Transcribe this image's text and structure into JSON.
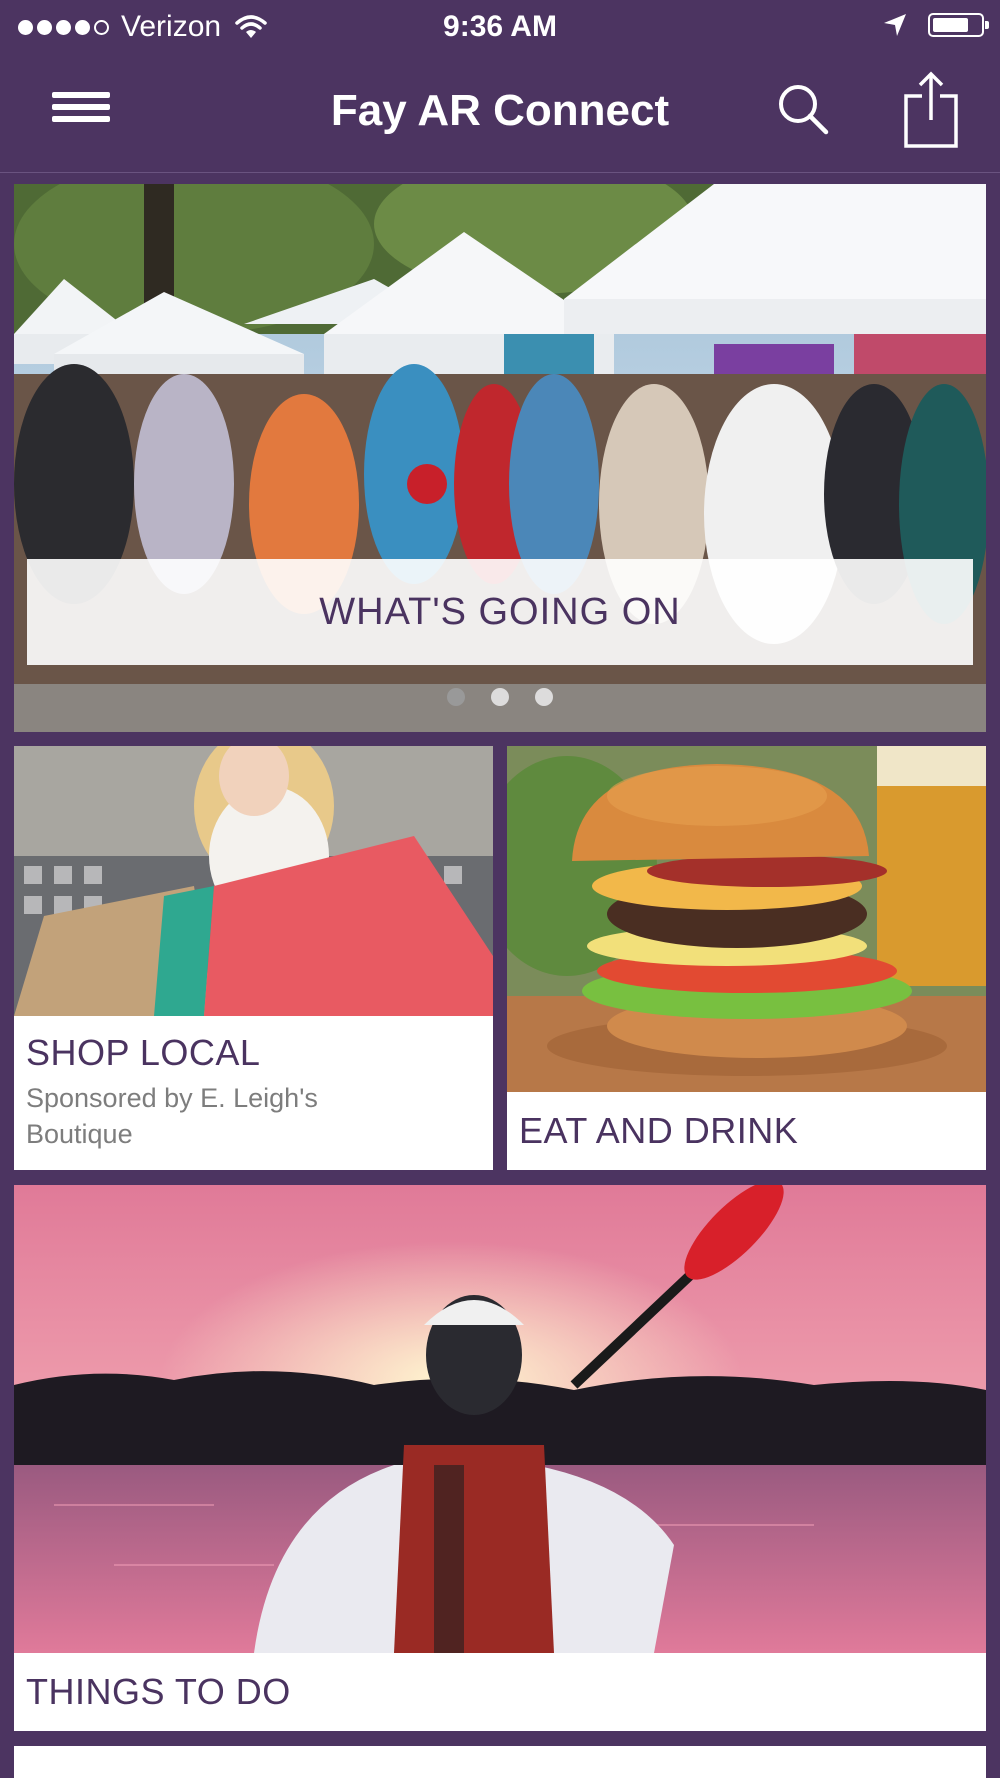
{
  "status_bar": {
    "carrier": "Verizon",
    "time": "9:36 AM",
    "signal_bars": 4,
    "battery_level": 0.75
  },
  "header": {
    "title": "Fay AR Connect",
    "icons": [
      "menu-icon",
      "search-icon",
      "share-icon"
    ]
  },
  "hero": {
    "label": "WHAT'S GOING ON",
    "pages": 3,
    "active_page": 1
  },
  "cards": {
    "shop": {
      "title": "SHOP LOCAL",
      "sponsor_line1": "Sponsored by E. Leigh's",
      "sponsor_line2": "Boutique"
    },
    "eat": {
      "title": "EAT AND DRINK"
    },
    "todo": {
      "title": "THINGS TO DO"
    }
  },
  "colors": {
    "brand_purple": "#4c3461",
    "title_purple": "#4a3360"
  }
}
